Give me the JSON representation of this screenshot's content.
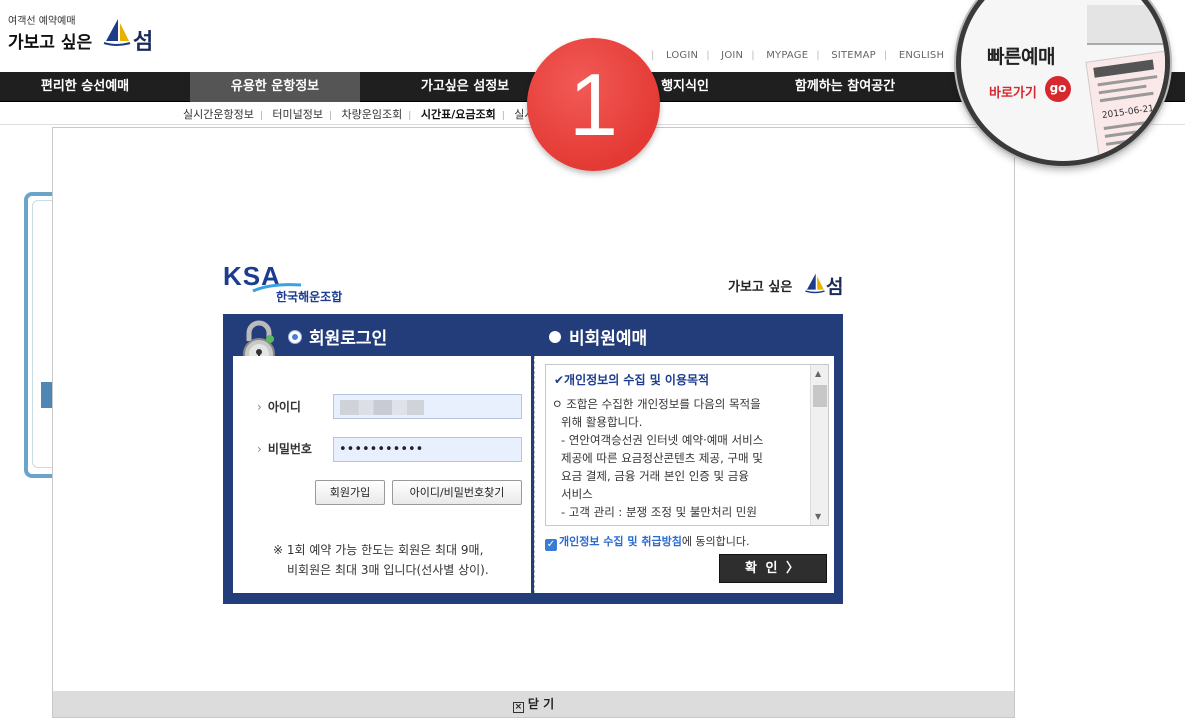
{
  "header": {
    "logo_small": "여객선 예약예매",
    "logo_main": "가보고 싶은",
    "logo_sum": "섬"
  },
  "top_nav": [
    "LOGIN",
    "JOIN",
    "MYPAGE",
    "SITEMAP",
    "ENGLISH"
  ],
  "main_nav": [
    "편리한 승선예매",
    "유용한 운항정보",
    "가고싶은 섬정보",
    "행지식인",
    "함께하는 참여공간"
  ],
  "sub_nav": [
    "실시간운항정보",
    "터미널정보",
    "차량운임조회",
    "시간표/요금조회",
    "실시"
  ],
  "step_badge": "1",
  "quick": {
    "title": "빠른예매",
    "go_label": "바로가기",
    "go": "go",
    "ticket_date": "2015-06-21"
  },
  "modal": {
    "ksa_logo": "KSA",
    "ksa_name": "한국해운조합",
    "brand": "가보고 싶은",
    "brand_sum": "섬",
    "tab_member": "회원로그인",
    "tab_guest": "비회원예매",
    "id_label": "아이디",
    "pw_label": "비밀번호",
    "pw_value": "•••••••••••",
    "join_button": "회원가입",
    "find_button": "아이디/비밀번호찾기",
    "note_line1": "※ 1회 예약 가능 한도는 회원은 최대 9매,",
    "note_line2": "비회원은 최대 3매 입니다(선사별 상이).",
    "privacy_title": "✔개인정보의 수집 및 이용목적",
    "privacy_lines": [
      "ㅇ 조합은 수집한 개인정보를 다음의 목적을",
      "위해 활용합니다.",
      "- 연안여객승선권 인터넷 예약·예매 서비스",
      "제공에 따른 요금정산콘텐츠 제공, 구매 및",
      "요금 결제, 금융 거래 본인 인증 및 금융",
      "서비스",
      "- 고객 관리 : 분쟁 조정 및 불만처리 민원"
    ],
    "agree_link": "개인정보 수집 및 취급방침",
    "agree_suffix": "에 동의합니다.",
    "confirm": "확 인 〉",
    "close": "닫 기"
  }
}
